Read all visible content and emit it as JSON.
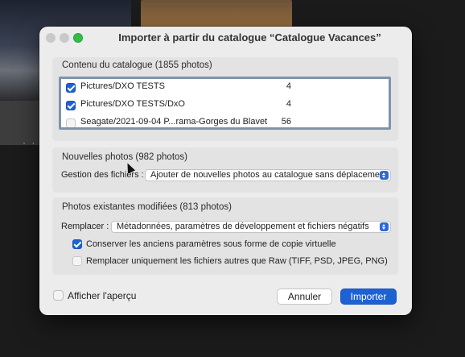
{
  "window": {
    "title": "Importer à partir du catalogue “Catalogue Vacances”"
  },
  "catalog": {
    "section_title": "Contenu du catalogue (1855 photos)",
    "items": [
      {
        "path": "Pictures/DXO TESTS",
        "count": "4",
        "checked": true
      },
      {
        "path": "Pictures/DXO TESTS/DxO",
        "count": "4",
        "checked": true
      },
      {
        "path": "Seagate/2021-09-04 P...rama-Gorges du Blavet",
        "count": "56",
        "checked": false
      }
    ]
  },
  "new_photos": {
    "section_title": "Nouvelles photos (982 photos)",
    "file_handling_label": "Gestion des fichiers :",
    "file_handling_value": "Ajouter de nouvelles photos au catalogue sans déplacement"
  },
  "modified_photos": {
    "section_title": "Photos existantes modifiées (813 photos)",
    "replace_label": "Remplacer :",
    "replace_value": "Métadonnées, paramètres de développement et fichiers négatifs",
    "keep_virtual_copy": {
      "label": "Conserver les anciens paramètres sous forme de copie virtuelle",
      "checked": true
    },
    "replace_non_raw": {
      "label": "Remplacer uniquement les fichiers autres que Raw (TIFF, PSD, JPEG, PNG)",
      "checked": false
    }
  },
  "footer": {
    "show_preview_label": "Afficher l'aperçu",
    "show_preview_checked": false,
    "cancel_label": "Annuler",
    "import_label": "Importer"
  },
  "colors": {
    "accent": "#1d61d3",
    "dialog_bg": "#ececec",
    "panel_bg": "#e3e3e3",
    "zoom_button": "#2fbf47"
  },
  "icons": {
    "traffic_lights": [
      "close-icon",
      "minimize-icon",
      "zoom-icon"
    ],
    "popup_stepper": "chevron-updown-icon",
    "cursor": "mouse-pointer-icon"
  }
}
